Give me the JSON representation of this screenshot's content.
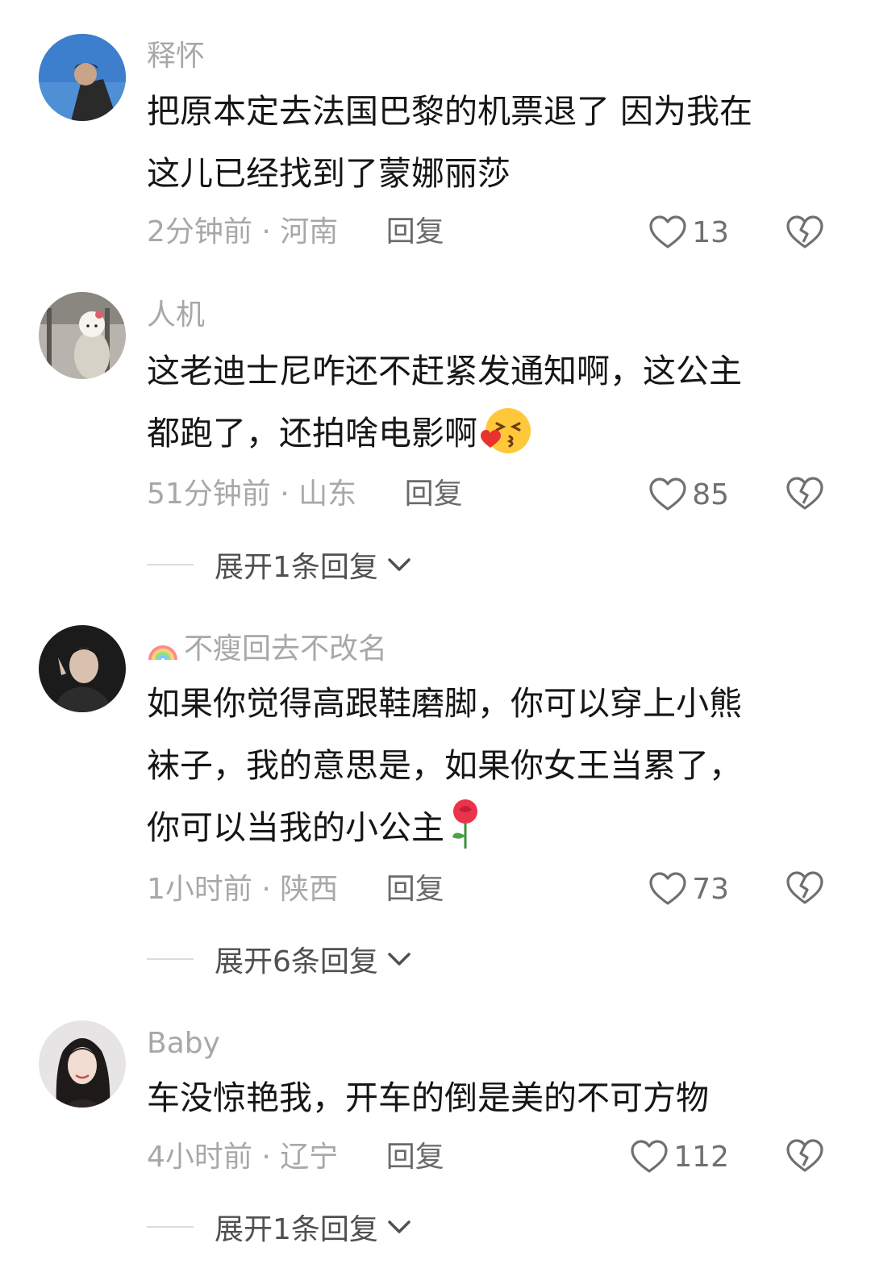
{
  "comments": [
    {
      "username": "释怀",
      "lines": [
        "把原本定去法国巴黎的机票退了 因为我在",
        "这儿已经找到了蒙娜丽莎"
      ],
      "time": "2分钟前",
      "location": "河南",
      "reply_label": "回复",
      "likes": "13"
    },
    {
      "username": "人机",
      "lines": [
        "这老迪士尼咋还不赶紧发通知啊，这公主",
        "都跑了，还拍啥电影啊"
      ],
      "emoji": "kiss-face-emoji",
      "time": "51分钟前",
      "location": "山东",
      "reply_label": "回复",
      "likes": "85",
      "expand_label": "展开1条回复"
    },
    {
      "username": "不瘦回去不改名",
      "username_prefix_icon": "rainbow-icon",
      "lines": [
        "如果你觉得高跟鞋磨脚，你可以穿上小熊",
        "袜子，我的意思是，如果你女王当累了，",
        "你可以当我的小公主"
      ],
      "emoji": "rose-emoji",
      "time": "1小时前",
      "location": "陕西",
      "reply_label": "回复",
      "likes": "73",
      "expand_label": "展开6条回复"
    },
    {
      "username": "Baby",
      "lines": [
        "车没惊艳我，开车的倒是美的不可方物"
      ],
      "time": "4小时前",
      "location": "辽宁",
      "reply_label": "回复",
      "likes": "112",
      "expand_label": "展开1条回复"
    }
  ],
  "meta_separator": " · ",
  "icons": {
    "like": "heart-outline-icon",
    "dislike": "broken-heart-icon",
    "expand": "chevron-down-icon"
  },
  "colors": {
    "text_primary": "#161616",
    "text_secondary": "#a8a8a8",
    "reply": "#6a6a6a"
  }
}
